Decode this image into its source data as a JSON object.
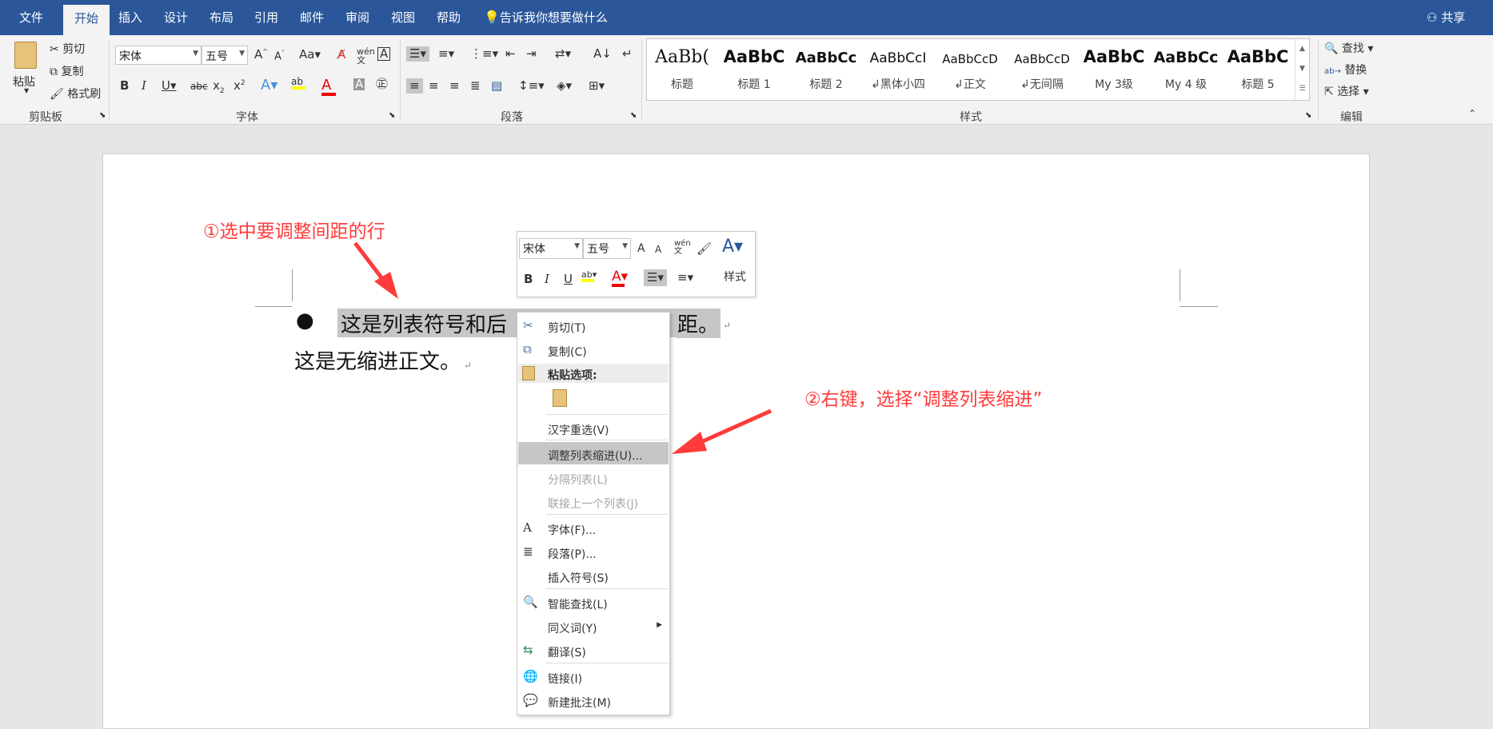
{
  "tabs": [
    "文件",
    "开始",
    "插入",
    "设计",
    "布局",
    "引用",
    "邮件",
    "审阅",
    "视图",
    "帮助",
    "告诉我你想要做什么"
  ],
  "share": "共享",
  "clipboard": {
    "paste": "粘贴",
    "cut": "剪切",
    "copy": "复制",
    "format_painter": "格式刷",
    "group": "剪贴板"
  },
  "font": {
    "name": "宋体",
    "size": "五号",
    "group": "字体"
  },
  "paragraph": {
    "group": "段落"
  },
  "styles": {
    "group": "样式",
    "items": [
      {
        "sample": "AaBb(",
        "name": "标题"
      },
      {
        "sample": "AaBbC",
        "name": "标题 1"
      },
      {
        "sample": "AaBbCc",
        "name": "标题 2"
      },
      {
        "sample": "AaBbCcI",
        "name": "↲黑体小四"
      },
      {
        "sample": "AaBbCcD",
        "name": "↲正文"
      },
      {
        "sample": "AaBbCcD",
        "name": "↲无间隔"
      },
      {
        "sample": "AaBbC",
        "name": "My 3级"
      },
      {
        "sample": "AaBbCc",
        "name": "My 4 级"
      },
      {
        "sample": "AaBbC",
        "name": "标题 5"
      }
    ]
  },
  "editing": {
    "find": "查找",
    "replace": "替换",
    "select": "选择",
    "group": "编辑"
  },
  "annotations": {
    "step1": "①选中要调整间距的行",
    "step2": "②右键，选择“调整列表缩进”"
  },
  "document": {
    "line1": "这是列表符号和后",
    "line1_tail": "距。",
    "line2": "这是无缩进正文。",
    "bullet": "●"
  },
  "mini_toolbar": {
    "font": "宋体",
    "size": "五号",
    "styles_label": "样式"
  },
  "context_menu": {
    "items": [
      {
        "label": "剪切(T)",
        "icon": "scissors-icon",
        "state": "normal"
      },
      {
        "label": "复制(C)",
        "icon": "copy-icon",
        "state": "normal"
      },
      {
        "label": "粘贴选项:",
        "icon": "paste-icon",
        "state": "caption"
      },
      {
        "label": "汉字重选(V)",
        "state": "normal"
      },
      {
        "label": "调整列表缩进(U)...",
        "state": "highlighted"
      },
      {
        "label": "分隔列表(L)",
        "state": "disabled"
      },
      {
        "label": "联接上一个列表(J)",
        "state": "disabled"
      },
      {
        "label": "字体(F)...",
        "icon": "font-icon",
        "state": "normal"
      },
      {
        "label": "段落(P)...",
        "icon": "paragraph-icon",
        "state": "normal"
      },
      {
        "label": "插入符号(S)",
        "state": "normal"
      },
      {
        "label": "智能查找(L)",
        "icon": "smart-lookup-icon",
        "state": "normal"
      },
      {
        "label": "同义词(Y)",
        "state": "normal",
        "submenu": true
      },
      {
        "label": "翻译(S)",
        "icon": "translate-icon",
        "state": "normal"
      },
      {
        "label": "链接(I)",
        "icon": "link-icon",
        "state": "normal"
      },
      {
        "label": "新建批注(M)",
        "icon": "comment-icon",
        "state": "normal"
      }
    ]
  },
  "colors": {
    "accent": "#2b579a",
    "annotation": "#ff3b3b",
    "highlight": "#c6c6c6"
  }
}
